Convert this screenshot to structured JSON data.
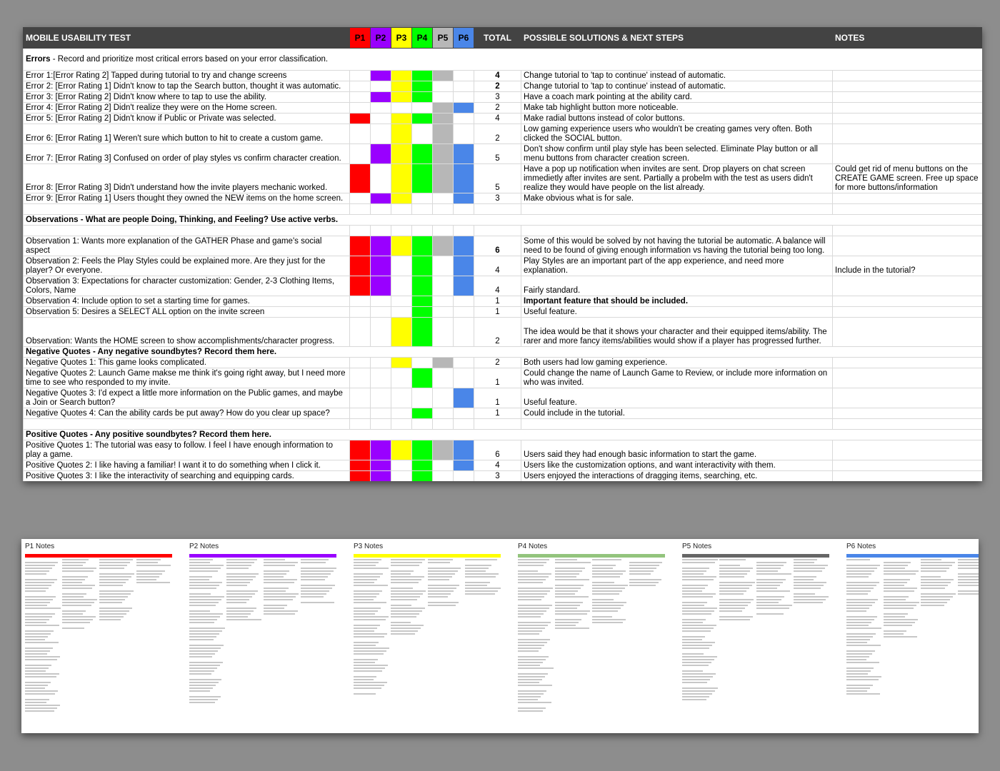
{
  "colors": {
    "P1": "#ff0000",
    "P2": "#9900ff",
    "P3": "#ffff00",
    "P4": "#00ff00",
    "P5": "#b7b7b7",
    "P6": "#4a86e8",
    "header_bg": "#434343"
  },
  "headers": {
    "title": "MOBILE USABILITY TEST",
    "participants": [
      "P1",
      "P2",
      "P3",
      "P4",
      "P5",
      "P6"
    ],
    "total": "TOTAL",
    "solutions": "POSSIBLE SOLUTIONS & NEXT STEPS",
    "notes": "NOTES"
  },
  "rows": [
    {
      "kind": "section",
      "bold_prefix": "Errors",
      "text": " - Record and prioritize most critical errors based on your error classification.",
      "h": 31
    },
    {
      "kind": "item",
      "text": "Error 1:[Error Rating 2] Tapped during tutorial to try and change screens",
      "marks": [
        0,
        1,
        1,
        1,
        1,
        0
      ],
      "total": "4",
      "total_bold": true,
      "solution": "Change tutorial to 'tap to continue' instead of automatic.",
      "note": "",
      "h": 15
    },
    {
      "kind": "item",
      "text": "Error 2: [Error Rating 1] Didn't know to tap the Search button, thought it was automatic.",
      "marks": [
        0,
        0,
        1,
        1,
        0,
        0
      ],
      "total": "2",
      "total_bold": true,
      "solution": "Change tutorial to 'tap to continue' instead of automatic.",
      "note": "",
      "h": 15
    },
    {
      "kind": "item",
      "text": "Error 3: [Error Rating 2] Didn't know where to tap to use the ability.",
      "marks": [
        0,
        1,
        1,
        1,
        0,
        0
      ],
      "total": "3",
      "solution": "Have a coach mark pointing at the ability card.",
      "note": "",
      "h": 15
    },
    {
      "kind": "item",
      "text": "Error 4: [Error Rating 2] Didn't realize they were on the Home screen.",
      "marks": [
        0,
        0,
        0,
        0,
        1,
        1
      ],
      "total": "2",
      "solution": "Make tab highlight button more noticeable.",
      "note": "",
      "h": 15
    },
    {
      "kind": "item",
      "text": "Error 5: [Error Rating 2] Didn't know if Public or Private was selected.",
      "marks": [
        1,
        0,
        1,
        1,
        1,
        0
      ],
      "total": "4",
      "solution": "Make radial buttons instead of color buttons.",
      "note": "",
      "h": 15
    },
    {
      "kind": "item",
      "text": "Error 6: [Error Rating 1] Weren't sure which button to hit to create a custom game.",
      "marks": [
        0,
        0,
        1,
        0,
        1,
        0
      ],
      "total": "2",
      "solution": "Low gaming experience users who wouldn't be creating games very often. Both clicked the SOCIAL button.",
      "note": "",
      "h": 28
    },
    {
      "kind": "item",
      "text": "Error 7: [Error Rating 3] Confused on order of play styles vs confirm character creation.",
      "marks": [
        0,
        1,
        1,
        1,
        1,
        1
      ],
      "total": "5",
      "solution": "Don't show confirm until play style has been selected. Eliminate Play button or all menu buttons from character creation screen.",
      "note": "",
      "h": 28
    },
    {
      "kind": "item",
      "text": "Error 8: [Error Rating 3] Didn't understand how the invite players mechanic worked.",
      "marks": [
        1,
        0,
        1,
        1,
        1,
        1
      ],
      "total": "5",
      "solution": "Have a pop up notification when invites are sent. Drop players on chat screen immedietly after invites are sent. Partially a probelm with the test as users didn't realize they would have people on the list already.",
      "note": "Could get rid of menu buttons on the CREATE GAME screen. Free up space for more buttons/information",
      "h": 41
    },
    {
      "kind": "item",
      "text": "Error 9: [Error Rating 1] Users thought they owned the NEW items on the home screen.",
      "marks": [
        0,
        1,
        1,
        0,
        0,
        1
      ],
      "total": "3",
      "solution": "Make obvious what is for sale.",
      "note": "",
      "h": 15
    },
    {
      "kind": "blank",
      "h": 15
    },
    {
      "kind": "section",
      "bold_prefix": "Observations - What are people Doing, Thinking, and Feeling? Use active verbs.",
      "text": "",
      "h": 15
    },
    {
      "kind": "blank",
      "h": 15
    },
    {
      "kind": "item",
      "text": "Observation 1: Wants more explanation of the GATHER Phase and game's social aspect",
      "marks": [
        1,
        1,
        1,
        1,
        1,
        1
      ],
      "total": "6",
      "total_bold": true,
      "solution": "Some of this would be solved by not having the tutorial be automatic. A balance will need to be found of giving enough information vs having the tutorial being too long.",
      "note": "",
      "h": 28
    },
    {
      "kind": "item",
      "text": "Observation 2: Feels the Play Styles could be explained more. Are they just for the player? Or everyone.",
      "marks": [
        1,
        1,
        0,
        1,
        0,
        1
      ],
      "total": "4",
      "solution": "Play Styles are an important part of the app experience, and need more explanation.",
      "note": "Include in the tutorial?",
      "h": 28
    },
    {
      "kind": "item",
      "text": "Observation 3: Expectations for character customization: Gender, 2-3 Clothing Items, Colors, Name",
      "marks": [
        1,
        1,
        0,
        1,
        0,
        1
      ],
      "total": "4",
      "solution": "Fairly standard.",
      "note": "",
      "h": 28
    },
    {
      "kind": "item",
      "text": "Observation 4: Include option to set a starting time for games.",
      "marks": [
        0,
        0,
        0,
        1,
        0,
        0
      ],
      "total": "1",
      "solution": "Important feature that should be included.",
      "solution_bold": true,
      "note": "",
      "h": 15
    },
    {
      "kind": "item",
      "text": "Observation 5: Desires a SELECT ALL option on the invite screen",
      "marks": [
        0,
        0,
        0,
        1,
        0,
        0
      ],
      "total": "1",
      "solution": "Useful feature.",
      "note": "",
      "h": 15
    },
    {
      "kind": "item",
      "text": "Observation: Wants the HOME screen to show accomplishments/character progress.",
      "marks": [
        0,
        0,
        1,
        1,
        0,
        0
      ],
      "total": "2",
      "solution": "The idea would be that it shows your character and their equipped items/ability. The rarer and more fancy items/abilities would show if a player has progressed further.",
      "note": "",
      "h": 41
    },
    {
      "kind": "section",
      "bold_prefix": "Negative Quotes - Any negative soundbytes? Record them here.",
      "text": "",
      "h": 15
    },
    {
      "kind": "item",
      "text": "Negative Quotes 1: This game looks complicated.",
      "marks": [
        0,
        0,
        1,
        0,
        1,
        0
      ],
      "total": "2",
      "solution": "Both users had low gaming experience.",
      "note": "",
      "h": 15
    },
    {
      "kind": "item",
      "text": "Negative Quotes 2: Launch Game makse me think it's going right away, but I need more time to see who responded to my invite.",
      "marks": [
        0,
        0,
        0,
        1,
        0,
        0
      ],
      "total": "1",
      "solution": "Could change the name of Launch Game to Review, or include more information on who was invited.",
      "note": "",
      "h": 28
    },
    {
      "kind": "item",
      "text": "Negative Quotes 3: I'd expect a little more information on the Public games, and maybe a Join or Search button?",
      "marks": [
        0,
        0,
        0,
        0,
        0,
        1
      ],
      "total": "1",
      "solution": "Useful feature.",
      "note": "",
      "h": 28
    },
    {
      "kind": "item",
      "text": "Negative Quotes 4: Can the ability cards be put away? How do you clear up space?",
      "marks": [
        0,
        0,
        0,
        1,
        0,
        0
      ],
      "total": "1",
      "solution": "Could include in the tutorial.",
      "note": "",
      "h": 15
    },
    {
      "kind": "blank",
      "h": 15
    },
    {
      "kind": "section",
      "bold_prefix": "Positive Quotes - Any positive soundbytes? Record them here.",
      "text": "",
      "h": 15
    },
    {
      "kind": "item",
      "text": "Positive Quotes 1: The tutorial was easy to follow. I feel I have enough information to play a game.",
      "marks": [
        1,
        1,
        1,
        1,
        1,
        1
      ],
      "total": "6",
      "solution": "Users said they had enough basic information to start the game.",
      "note": "",
      "h": 28
    },
    {
      "kind": "item",
      "text": "Positive Quotes 2: I like having a familiar! I want it to do something when I click it.",
      "marks": [
        1,
        1,
        0,
        1,
        0,
        1
      ],
      "total": "4",
      "solution": "Users like the customization options, and want interactivity with them.",
      "note": "",
      "h": 15
    },
    {
      "kind": "item",
      "text": "Positive Quotes 3: I like the interactivity of searching and equipping cards.",
      "marks": [
        1,
        1,
        0,
        1,
        0,
        0
      ],
      "total": "3",
      "solution": "Users enjoyed the interactions of dragging items, searching, etc.",
      "note": "",
      "h": 15
    }
  ],
  "notes_panels": [
    {
      "title": "P1 Notes",
      "color": "#ff0000"
    },
    {
      "title": "P2 Notes",
      "color": "#9900ff"
    },
    {
      "title": "P3 Notes",
      "color": "#ffff00"
    },
    {
      "title": "P4 Notes",
      "color": "#93c47d"
    },
    {
      "title": "P5 Notes",
      "color": "#666666"
    },
    {
      "title": "P6 Notes",
      "color": "#4a86e8"
    }
  ]
}
